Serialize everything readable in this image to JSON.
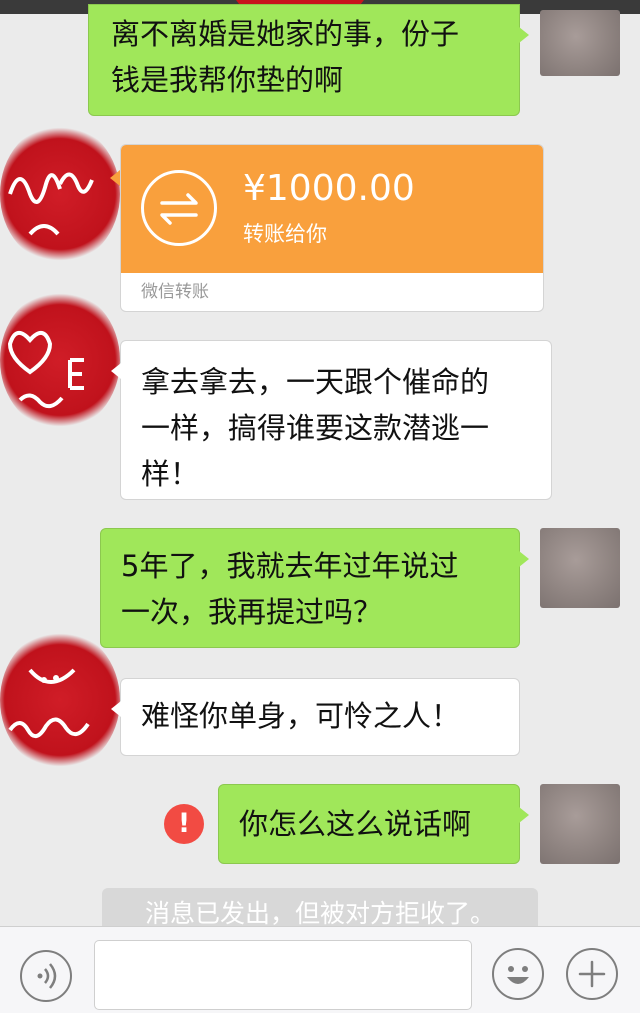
{
  "messages": {
    "m1": {
      "lines": [
        "离不离婚是她家的事，份子",
        "钱是我帮你垫的啊"
      ]
    },
    "transfer": {
      "amount": "¥1000.00",
      "desc": "转账给你",
      "footer": "微信转账"
    },
    "m3": {
      "lines": [
        "拿去拿去，一天跟个催命的",
        "一样，搞得谁要这款潜逃一",
        "样！"
      ]
    },
    "m4": {
      "lines": [
        "5年了，我就去年过年说过",
        "一次，我再提过吗？"
      ]
    },
    "m5": {
      "lines": [
        "难怪你单身，可怜之人！"
      ]
    },
    "m6": {
      "lines": [
        "你怎么这么说话啊"
      ]
    }
  },
  "error_mark": "!",
  "system_notice": "消息已发出，但被对方拒收了。",
  "icons": {
    "voice": "voice-icon",
    "emoji": "emoji-icon",
    "add": "plus-icon",
    "transfer": "transfer-arrows-icon",
    "error": "alert-icon"
  },
  "colors": {
    "sent_bubble": "#a0e75a",
    "received_bubble": "#ffffff",
    "transfer_card": "#f9a03d",
    "error": "#f24b43",
    "background": "#ebebeb"
  }
}
